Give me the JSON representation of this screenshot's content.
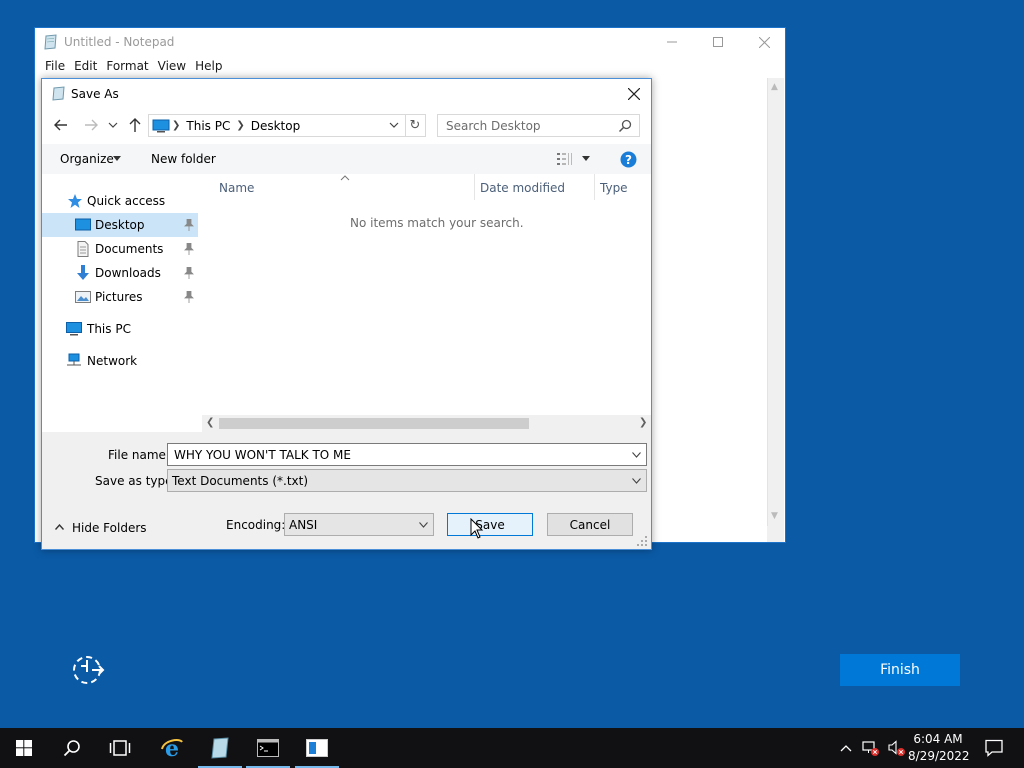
{
  "notepad": {
    "title": "Untitled - Notepad",
    "menu": [
      "File",
      "Edit",
      "Format",
      "View",
      "Help"
    ]
  },
  "dialog": {
    "title": "Save As",
    "breadcrumb": [
      "This PC",
      "Desktop"
    ],
    "search_placeholder": "Search Desktop",
    "toolbar": {
      "organize": "Organize",
      "new_folder": "New folder"
    },
    "nav": {
      "quick_access": "Quick access",
      "items": [
        "Desktop",
        "Documents",
        "Downloads",
        "Pictures"
      ],
      "this_pc": "This PC",
      "network": "Network"
    },
    "columns": {
      "name": "Name",
      "date_modified": "Date modified",
      "type": "Type"
    },
    "empty_message": "No items match your search.",
    "file_name_label": "File name:",
    "file_name_value": "WHY YOU WON'T TALK TO ME",
    "save_as_type_label": "Save as type:",
    "save_as_type_value": "Text Documents (*.txt)",
    "hide_folders": "Hide Folders",
    "encoding_label": "Encoding:",
    "encoding_value": "ANSI",
    "save_button": "Save",
    "cancel_button": "Cancel"
  },
  "desktop": {
    "finish_button": "Finish",
    "accent_color": "#0078d7",
    "background_color": "#0b5aa6"
  },
  "taskbar": {
    "time": "6:04 AM",
    "date": "8/29/2022",
    "icons": [
      "start-icon",
      "search-icon",
      "task-view-icon",
      "internet-explorer-icon",
      "notepad-icon",
      "command-prompt-icon",
      "setup-window-icon"
    ]
  }
}
